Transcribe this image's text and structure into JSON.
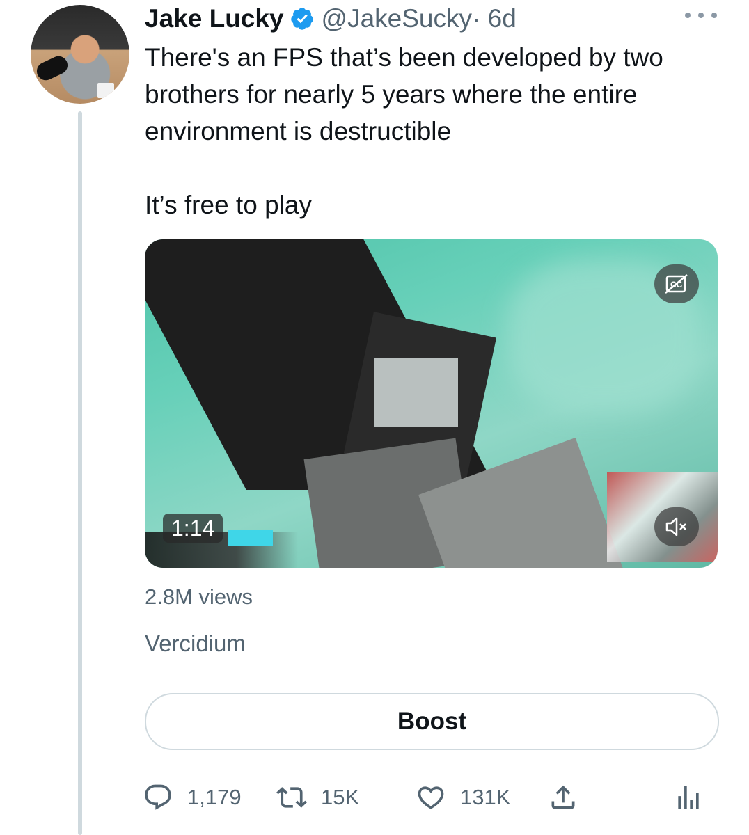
{
  "author": {
    "name": "Jake Lucky",
    "handle": "@JakeSucky",
    "time": "· 6d"
  },
  "tweet": {
    "line1": "There's an FPS that’s been developed by two brothers for nearly 5 years where the entire environment is destructible",
    "line2": "It’s free to play"
  },
  "video": {
    "duration": "1:14"
  },
  "stats": {
    "views": "2.8M views",
    "source": "Vercidium"
  },
  "boost_label": "Boost",
  "actions": {
    "replies": "1,179",
    "retweets": "15K",
    "likes": "131K"
  },
  "icons": [
    "verified-badge-icon",
    "more-icon",
    "closed-captions-icon",
    "mute-icon",
    "reply-icon",
    "retweet-icon",
    "like-icon",
    "share-icon",
    "analytics-icon"
  ],
  "colors": {
    "verified": "#1d9bf0",
    "secondary_text": "#536471",
    "border": "#cfd9de"
  }
}
